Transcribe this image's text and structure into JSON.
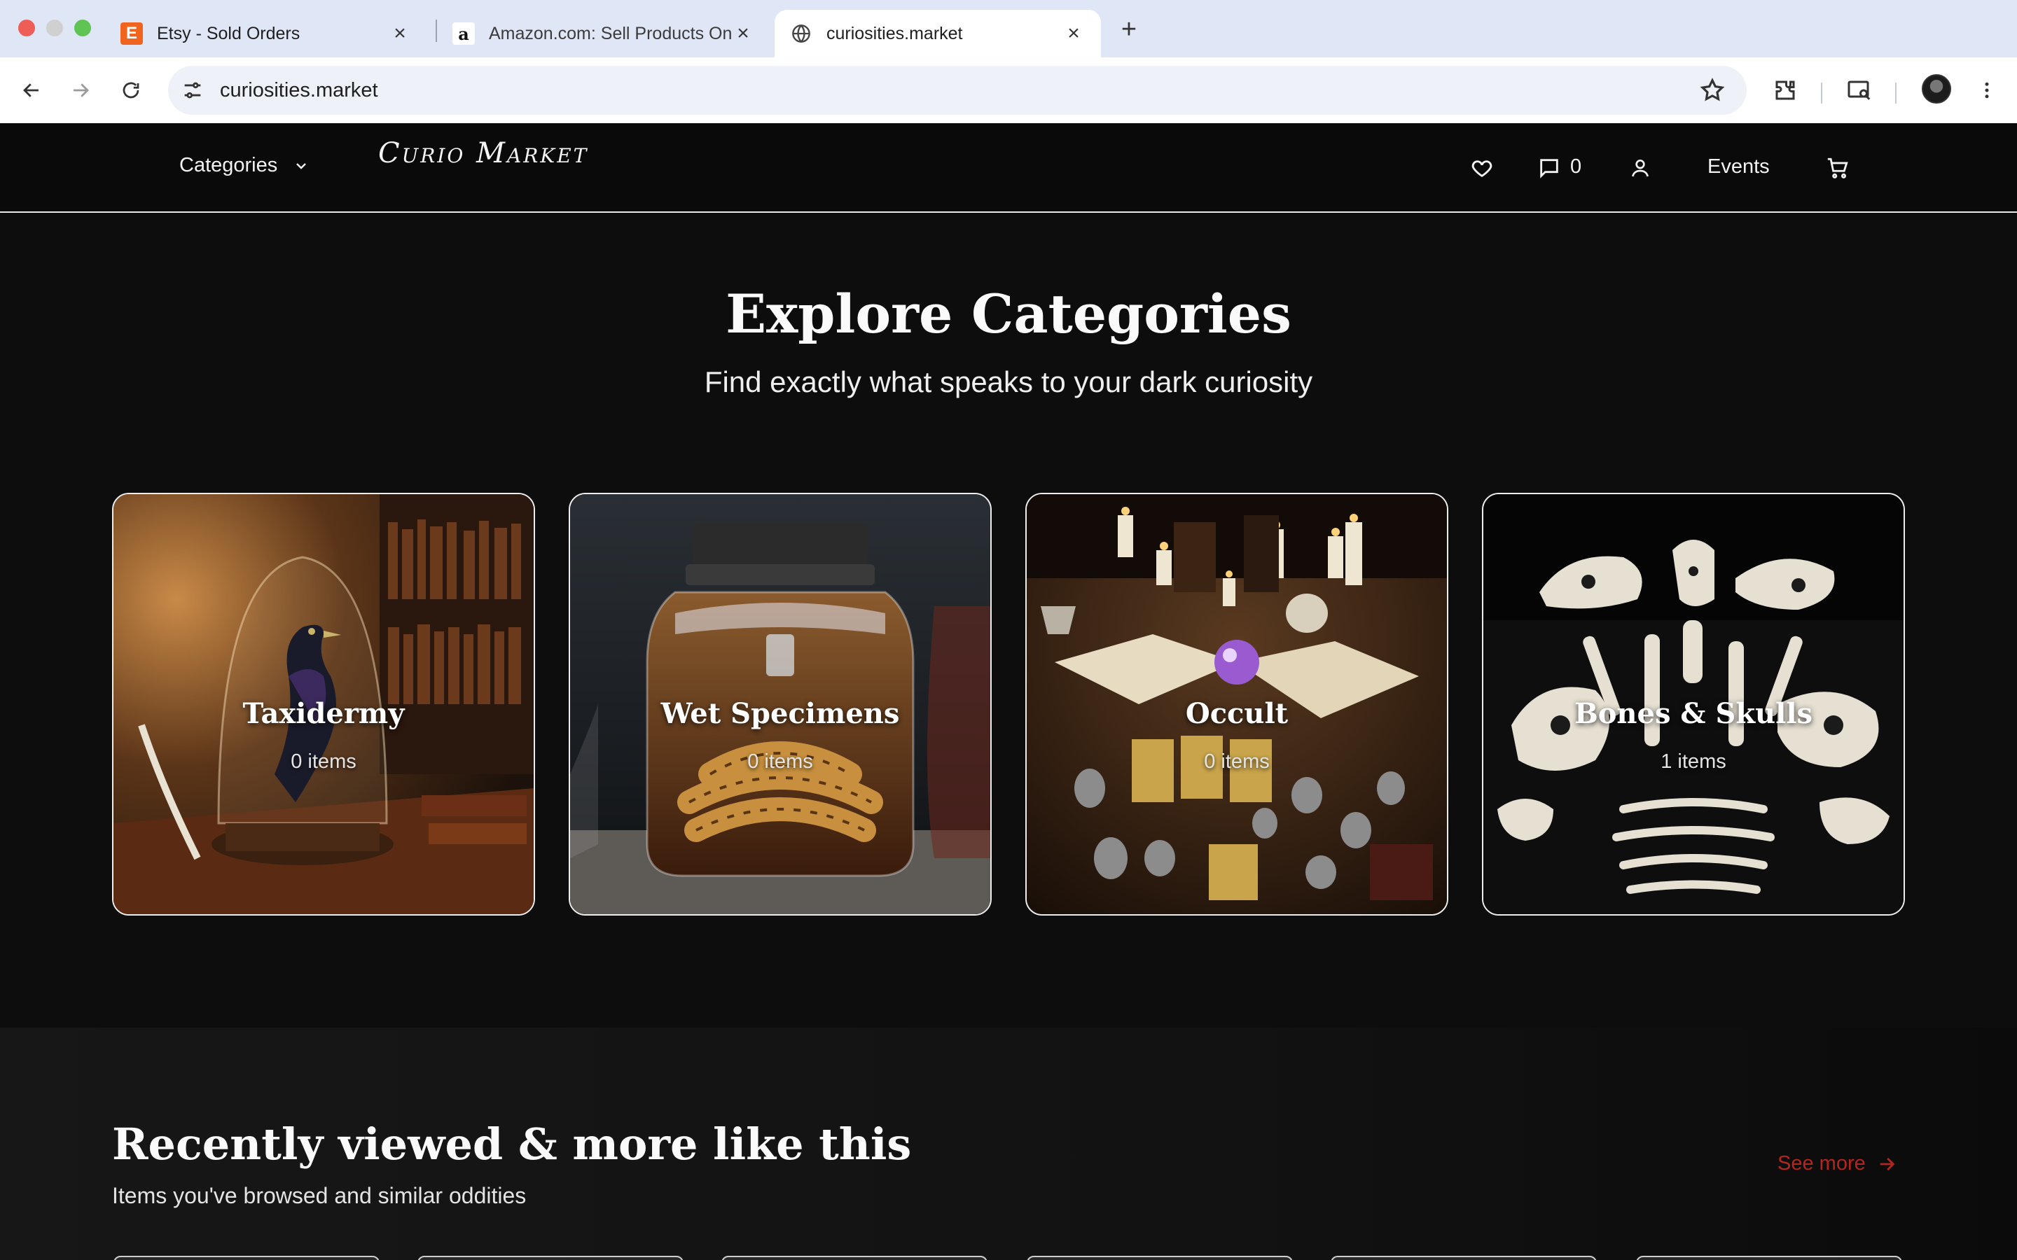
{
  "browser": {
    "tabs": [
      {
        "title": "Etsy - Sold Orders",
        "favicon": "E",
        "favicon_color": "#f1641e"
      },
      {
        "title": "Amazon.com: Sell Products Online",
        "favicon": "a",
        "favicon_color": "#111111"
      },
      {
        "title": "curiosities.market",
        "favicon": "globe-icon",
        "active": true
      }
    ],
    "url": "curiosities.market"
  },
  "header": {
    "categories_label": "Categories",
    "logo_text": "Curio Market",
    "message_count": "0",
    "events_label": "Events"
  },
  "explore": {
    "title": "Explore Categories",
    "subtitle": "Find exactly what speaks to your dark curiosity",
    "categories": [
      {
        "name": "Taxidermy",
        "count": "0 items"
      },
      {
        "name": "Wet Specimens",
        "count": "0 items"
      },
      {
        "name": "Occult",
        "count": "0 items"
      },
      {
        "name": "Bones & Skulls",
        "count": "1 items"
      }
    ]
  },
  "recent": {
    "title": "Recently viewed & more like this",
    "subtitle": "Items you've browsed and similar oddities",
    "see_more_label": "See more"
  },
  "colors": {
    "accent": "#b3261e",
    "page_bg": "#0d0d0d"
  }
}
